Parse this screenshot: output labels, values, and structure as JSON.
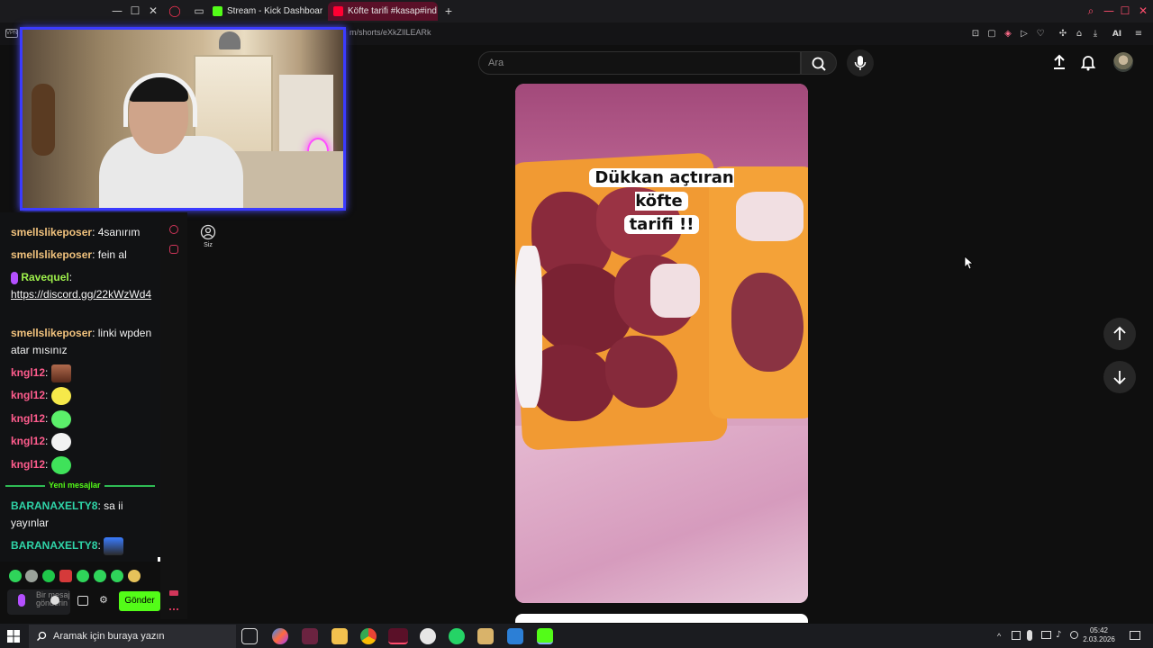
{
  "browser": {
    "tabs": [
      {
        "label": "Stream - Kick Dashboard",
        "icon": "kick-icon",
        "color": "#53fc18"
      },
      {
        "label": "Köfte tarifi #kasap#ind",
        "icon": "speaker-icon",
        "color": "#ff0033",
        "active": true
      }
    ],
    "url": "m/shorts/eXkZIlLEARk",
    "extension_label": "AI"
  },
  "youtube": {
    "search_placeholder": "Ara",
    "rail_you_label": "Siz",
    "short_caption_line1": "Dükkan açtıran köfte",
    "short_caption_line2": "tarifi !!"
  },
  "chat": {
    "messages": [
      {
        "user": "smellslikeposer",
        "text": "4sanırım",
        "color": "#f1c27d"
      },
      {
        "user": "smellslikeposer",
        "text": "fein al",
        "color": "#f1c27d"
      },
      {
        "user": "Ravequel",
        "text": "https://discord.gg/22kWzWd4",
        "color": "#9ef04b",
        "badge": "mic-badge-icon"
      },
      {
        "user": "smellslikeposer",
        "text": "linki wpden atar mısınız",
        "color": "#f1c27d"
      },
      {
        "user": "kngl12",
        "text": "",
        "color": "#ff5c8d",
        "emote": "face-emote"
      },
      {
        "user": "kngl12",
        "text": "",
        "color": "#ff5c8d",
        "emote": "yellow-emote"
      },
      {
        "user": "kngl12",
        "text": "",
        "color": "#ff5c8d",
        "emote": "green-emote"
      },
      {
        "user": "kngl12",
        "text": "",
        "color": "#ff5c8d",
        "emote": "skull-emote"
      },
      {
        "user": "kngl12",
        "text": "",
        "color": "#ff5c8d",
        "emote": "green-blob-emote"
      },
      {
        "user": "BARANAXELTY8",
        "text": "sa ii yayınlar",
        "color": "#2fd4a8"
      },
      {
        "user": "BARANAXELTY8",
        "text": "",
        "color": "#2fd4a8",
        "emote": "car-emote"
      }
    ],
    "colon": ":",
    "new_messages_label": "Yeni mesajlar",
    "input_placeholder": "Bir mesaj gönderin",
    "send_label": "Gönder"
  },
  "taskbar": {
    "search_placeholder": "Aramak için buraya yazın",
    "time": "05:42",
    "date": "2.03.2026"
  }
}
